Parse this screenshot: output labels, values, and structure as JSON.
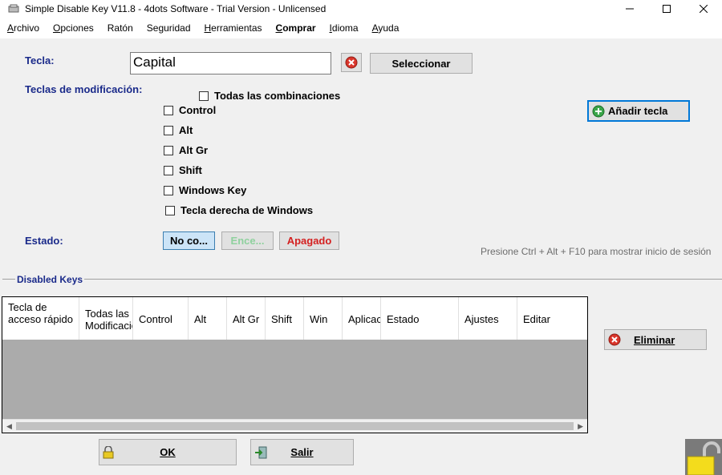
{
  "window": {
    "title": "Simple Disable Key V11.8 - 4dots Software - Trial Version - Unlicensed"
  },
  "menu": [
    {
      "first": "A",
      "rest": "rchivo",
      "bold": false
    },
    {
      "first": "O",
      "rest": "pciones",
      "bold": false
    },
    {
      "first": "",
      "rest": "Ratón",
      "bold": false
    },
    {
      "first": "",
      "rest": "Seguridad",
      "bold": false
    },
    {
      "first": "H",
      "rest": "erramientas",
      "bold": false
    },
    {
      "first": "C",
      "rest": "omprar",
      "bold": true
    },
    {
      "first": "I",
      "rest": "dioma",
      "bold": false
    },
    {
      "first": "A",
      "rest": "yuda",
      "bold": false
    }
  ],
  "key": {
    "label": "Tecla:",
    "value": "Capital",
    "select_label": "Seleccionar"
  },
  "modifiers": {
    "label": "Teclas de modificación:",
    "all": "Todas las combinaciones",
    "control": "Control",
    "alt": "Alt",
    "altgr": "Alt Gr",
    "shift": "Shift",
    "windows": "Windows Key",
    "windows_right": "Tecla derecha de Windows"
  },
  "add_key_label": "Añadir tecla",
  "state": {
    "label": "Estado:",
    "not_configured": "No co...",
    "on": "Ence...",
    "off": "Apagado"
  },
  "hint": "Presione Ctrl + Alt + F10 para mostrar inicio de sesión",
  "disabled_keys": {
    "title": "Disabled Keys",
    "columns": [
      "Tecla de acceso rápido",
      "Todas las Modificaciones",
      "Control",
      "Alt",
      "Alt Gr",
      "Shift",
      "Win",
      "Aplicaciones",
      "Estado",
      "Ajustes",
      "Editar"
    ]
  },
  "delete_label": "Eliminar",
  "ok_label": "OK",
  "exit_label": "Salir",
  "colors": {
    "label_blue": "#1a2a8a",
    "on_green": "#4caf50",
    "off_red": "#d42020",
    "focus_blue": "#0078d7"
  }
}
